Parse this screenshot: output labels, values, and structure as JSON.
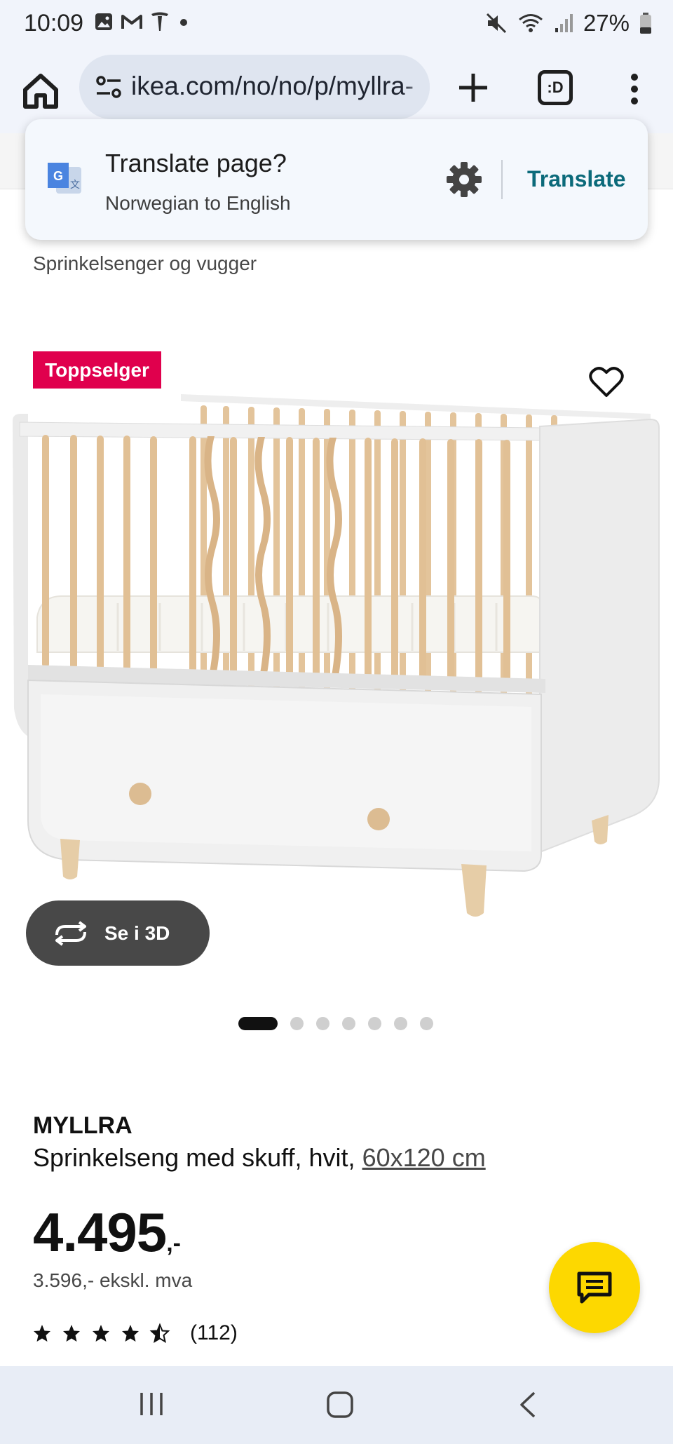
{
  "status_bar": {
    "time": "10:09",
    "battery": "27%",
    "icons_left": [
      "gallery-icon",
      "gmail-icon",
      "tesla-icon",
      "dot-icon"
    ],
    "icons_right": [
      "mute-icon",
      "wifi-icon",
      "signal-icon",
      "battery-icon"
    ]
  },
  "browser": {
    "url": "ikea.com/no/no/p/myllra-",
    "tab_switcher_label": ":D"
  },
  "translate_popup": {
    "title": "Translate page?",
    "subtitle": "Norwegian to English",
    "action": "Translate"
  },
  "breadcrumb": "Sprinkelsenger og vugger",
  "product": {
    "badge": "Toppselger",
    "view_3d_label": "Se i 3D",
    "image_count": 7,
    "active_image": 1,
    "brand": "MYLLRA",
    "description": "Sprinkelseng med skuff, hvit,",
    "size": "60x120 cm",
    "price": "4.495",
    "price_suffix": ",-",
    "price_ex_vat": "3.596,- ekskl. mva",
    "rating": 4.5,
    "rating_max": 5,
    "review_count": "(112)"
  },
  "colors": {
    "badge": "#e0004d",
    "chat_fab": "#fdd800",
    "translate_action": "#0b6a7a",
    "wood": "#e3c49b"
  }
}
